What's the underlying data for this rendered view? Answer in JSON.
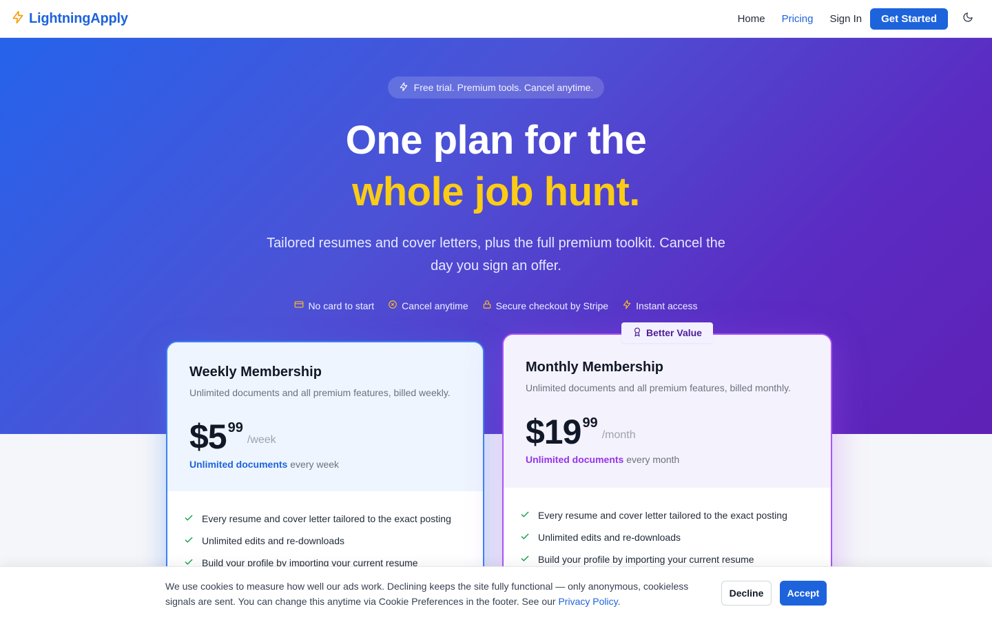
{
  "brand": {
    "name": "LightningApply",
    "icon": "lightning-bolt-icon"
  },
  "nav": {
    "links": [
      {
        "label": "Home",
        "active": false
      },
      {
        "label": "Pricing",
        "active": true
      },
      {
        "label": "Sign In",
        "active": false
      }
    ],
    "cta": "Get Started",
    "theme_icon": "moon-icon"
  },
  "hero": {
    "pill": "Free trial. Premium tools. Cancel anytime.",
    "headline_line1": "One plan for the",
    "headline_line2": "whole job hunt.",
    "subtitle": "Tailored resumes and cover letters, plus the full premium toolkit. Cancel the day you sign an offer.",
    "badges": [
      {
        "icon": "credit-card-icon",
        "label": "No card to start"
      },
      {
        "icon": "x-circle-icon",
        "label": "Cancel anytime"
      },
      {
        "icon": "lock-icon",
        "label": "Secure checkout by Stripe"
      },
      {
        "icon": "lightning-bolt-icon",
        "label": "Instant access"
      }
    ]
  },
  "plans": {
    "weekly": {
      "title": "Weekly Membership",
      "description": "Unlimited documents and all premium features, billed weekly.",
      "price_main": "$5",
      "price_cents": "99",
      "period": "/week",
      "docs_strong": "Unlimited documents",
      "docs_rest": " every week",
      "features": [
        "Every resume and cover letter tailored to the exact posting",
        "Unlimited edits and re-downloads",
        "Build your profile by importing your current resume"
      ]
    },
    "monthly": {
      "ribbon": "Better Value",
      "title": "Monthly Membership",
      "description": "Unlimited documents and all premium features, billed monthly.",
      "price_main": "$19",
      "price_cents": "99",
      "period": "/month",
      "docs_strong": "Unlimited documents",
      "docs_rest": " every month",
      "features": [
        "Every resume and cover letter tailored to the exact posting",
        "Unlimited edits and re-downloads",
        "Build your profile by importing your current resume"
      ]
    }
  },
  "cookie": {
    "text": "We use cookies to measure how well our ads work. Declining keeps the site fully functional — only anonymous, cookieless signals are sent. You can change this anytime via Cookie Preferences in the footer. See our ",
    "link": "Privacy Policy",
    "end": ".",
    "decline": "Decline",
    "accept": "Accept"
  },
  "colors": {
    "brand": "#1d63dc",
    "highlight": "#facc15",
    "weekly_accent": "#3b82f6",
    "monthly_accent": "#a855f7",
    "check": "#16a34a"
  }
}
